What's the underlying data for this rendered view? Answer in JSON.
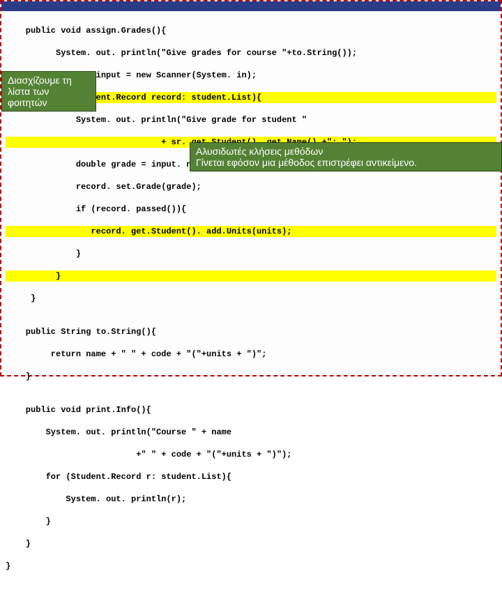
{
  "callouts": {
    "left": {
      "line1": "Διασχίζουμε τη",
      "line2": "λίστα των",
      "line3": "φοιτητών"
    },
    "right": {
      "line1": "Αλυσιδωτές κλήσεις μεθόδων",
      "line2": "Γίνεται εφόσον μια μέθοδος επιστρέφει αντικείμενο."
    }
  },
  "code": {
    "l1": "    public void assign.Grades(){",
    "l2": "          System. out. println(\"Give grades for course \"+to.String());",
    "l3": "          Scanner input = new Scanner(System. in);",
    "l4": "          for(Student.Record record: student.List){",
    "l5": "              System. out. println(\"Give grade for student \"",
    "l6": "                               + sr. get.Student(). get.Name() +\": \");",
    "l7": "              double grade = input. next.Double();",
    "l8": "              record. set.Grade(grade);",
    "l9": "              if (record. passed()){",
    "l10": "                 record. get.Student(). add.Units(units);",
    "l11": "              }",
    "l12": "          }",
    "l13": "     }",
    "l14": "",
    "l15": "    public String to.String(){",
    "l16": "         return name + \" \" + code + \"(\"+units + \")\";",
    "l17": "    }",
    "l18": "",
    "l19": "    public void print.Info(){",
    "l20": "        System. out. println(\"Course \" + name",
    "l21": "                          +\" \" + code + \"(\"+units + \")\");",
    "l22": "        for (Student.Record r: student.List){",
    "l23": "            System. out. println(r);",
    "l24": "        }",
    "l25": "    }",
    "l26": "}"
  }
}
